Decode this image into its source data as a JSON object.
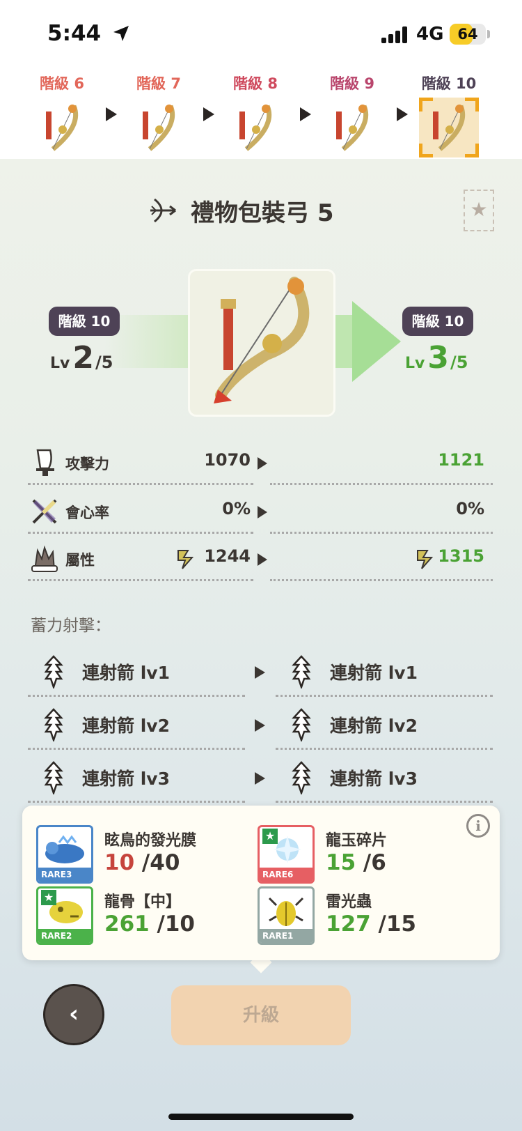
{
  "status": {
    "time": "5:44",
    "network": "4G",
    "battery": "64",
    "battery_level": 0.64
  },
  "grades": [
    {
      "label": "階級 6",
      "color": "#e2675a",
      "selected": false
    },
    {
      "label": "階級 7",
      "color": "#e2675a",
      "selected": false
    },
    {
      "label": "階級 8",
      "color": "#cf4a5e",
      "selected": false
    },
    {
      "label": "階級 9",
      "color": "#b9456c",
      "selected": false
    },
    {
      "label": "階級 10",
      "color": "#4e4256",
      "selected": true
    }
  ],
  "weapon": {
    "title": "禮物包裝弓 5"
  },
  "compare": {
    "left": {
      "grade": "階級 10",
      "lv_prefix": "Lv",
      "level": "2",
      "max": "/5"
    },
    "right": {
      "grade": "階級 10",
      "lv_prefix": "Lv",
      "level": "3",
      "max": "/5"
    }
  },
  "stats": [
    {
      "label": "攻擊力",
      "current": "1070",
      "next": "1121",
      "next_green": true
    },
    {
      "label": "會心率",
      "current": "0%",
      "next": "0%",
      "next_green": false
    },
    {
      "label": "屬性",
      "current": "1244",
      "next": "1315",
      "next_green": true
    }
  ],
  "charge_label": "蓄力射擊：",
  "shots": [
    {
      "current": "連射箭 lv1",
      "next": "連射箭 lv1"
    },
    {
      "current": "連射箭 lv2",
      "next": "連射箭 lv2"
    },
    {
      "current": "連射箭 lv3",
      "next": "連射箭 lv3"
    }
  ],
  "materials": [
    {
      "name": "眩鳥的發光膜",
      "have": "10",
      "need": " /40",
      "rare": "RARE3",
      "rare_color": "#4a86c8",
      "have_color": "red",
      "starred": false,
      "icon": "blue-lizard-icon"
    },
    {
      "name": "龍玉碎片",
      "have": "15",
      "need": " /6",
      "rare": "RARE6",
      "rare_color": "#e65f63",
      "have_color": "green",
      "starred": true,
      "icon": "crystal-icon"
    },
    {
      "name": "龍骨【中】",
      "have": "261",
      "need": " /10",
      "rare": "RARE2",
      "rare_color": "#4bb24a",
      "have_color": "green",
      "starred": true,
      "icon": "bone-icon"
    },
    {
      "name": "雷光蟲",
      "have": "127",
      "need": " /15",
      "rare": "RARE1",
      "rare_color": "#93a7a3",
      "have_color": "green",
      "starred": false,
      "icon": "beetle-icon"
    }
  ],
  "buttons": {
    "back": "‹",
    "upgrade": "升級"
  }
}
